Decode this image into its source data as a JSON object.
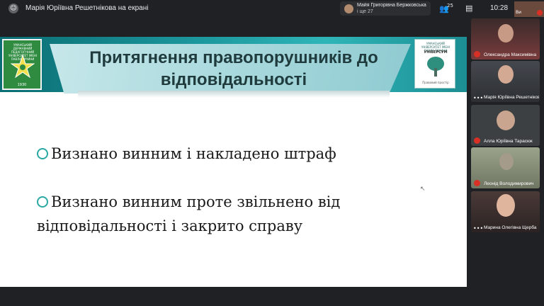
{
  "topbar": {
    "presenter_text": "Марія Юріївна Решетнікова на екрані",
    "presenter_avatar": "☺",
    "notification_line1": "Майя Григорівна Бержковська",
    "notification_line2": "і ще 27",
    "participants_count": "25",
    "clock": "10:28",
    "self_label": "Ви"
  },
  "slide": {
    "title": "Притягнення правопорушників до відповідальності",
    "bullets": [
      "Визнано винним і накладено штраф",
      "Визнано винним проте звільнено від відповідальності і закрито справу"
    ],
    "logo_left_text": "УМАНСЬКИЙ ДЕРЖАВНИЙ ПЕДАГОГІЧНИЙ УНІВЕРСИТЕТ ІМЕНІ ПАВЛА ТИЧИНИ",
    "logo_left_year": "1930",
    "logo_right_top": "УМАНСЬКИЙ УНІВЕРСИТЕТ ІМЕНІ ПАВЛА ТИЧИНИ",
    "logo_right_name": "УНІВЕРСУМ",
    "logo_right_bottom": "Правовий простір"
  },
  "participants": [
    {
      "name": "Олександра Максимівна",
      "muted": true
    },
    {
      "name": "Марія Юріївна Решетнікова",
      "muted": false
    },
    {
      "name": "Алла Юріївна Тарасюк",
      "muted": true
    },
    {
      "name": "Леонід Володимирович",
      "muted": true
    },
    {
      "name": "Марина Олегівна Щерба",
      "muted": false
    }
  ],
  "colors": {
    "accent_teal": "#2aa9a3",
    "mute_red": "#d93025",
    "bar_bg": "#202124"
  },
  "icons": [
    "user-circle-icon",
    "people-icon",
    "chat-icon",
    "mic-off-icon",
    "more-options-icon"
  ]
}
